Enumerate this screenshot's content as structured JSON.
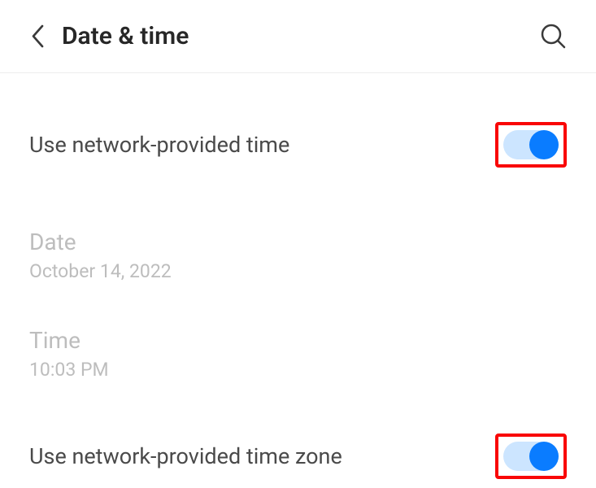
{
  "header": {
    "title": "Date & time"
  },
  "settings": {
    "use_network_time": {
      "label": "Use network-provided time",
      "enabled": true
    },
    "date": {
      "label": "Date",
      "value": "October 14, 2022"
    },
    "time": {
      "label": "Time",
      "value": "10:03 PM"
    },
    "use_network_timezone": {
      "label": "Use network-provided time zone",
      "enabled": true
    }
  }
}
